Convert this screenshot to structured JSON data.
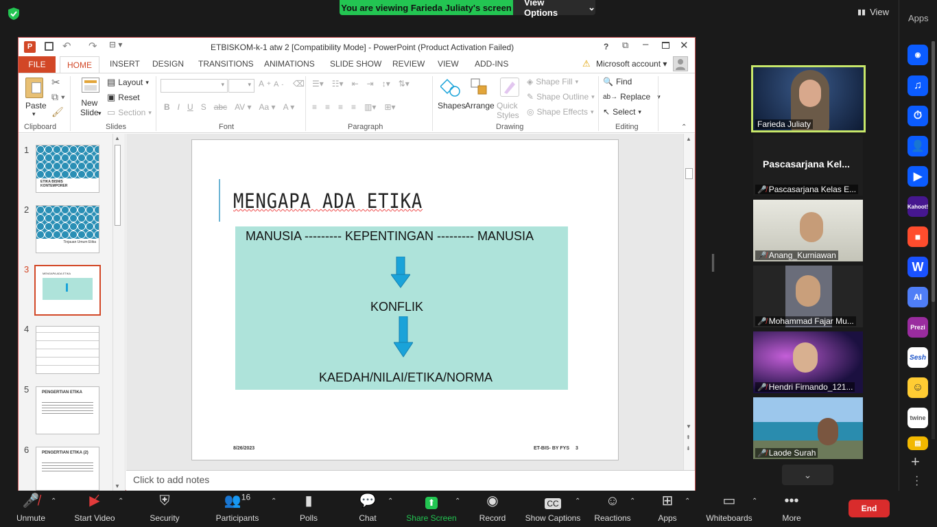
{
  "zoom": {
    "banner_text": "You are viewing Farieda Juliaty's screen",
    "view_options": "View Options",
    "view_label": "View",
    "apps_label": "Apps"
  },
  "ppt": {
    "title": "ETBISKOM-k-1 atw 2 [Compatibility Mode] - PowerPoint (Product Activation Failed)",
    "help": "?",
    "tabs": [
      "FILE",
      "HOME",
      "INSERT",
      "DESIGN",
      "TRANSITIONS",
      "ANIMATIONS",
      "SLIDE SHOW",
      "REVIEW",
      "VIEW",
      "ADD-INS"
    ],
    "account": "Microsoft account",
    "ribbon": {
      "paste": "Paste",
      "layout": "Layout",
      "reset": "Reset",
      "new_slide": "New\nSlide",
      "section": "Section",
      "shapes": "Shapes",
      "arrange": "Arrange",
      "quick_styles": "Quick Styles",
      "shape_fill": "Shape Fill",
      "shape_outline": "Shape Outline",
      "shape_effects": "Shape Effects",
      "find": "Find",
      "replace": "Replace",
      "select": "Select",
      "groups": [
        "Clipboard",
        "Slides",
        "Font",
        "Paragraph",
        "Drawing",
        "Editing"
      ]
    },
    "thumb_numbers": [
      "1",
      "2",
      "3",
      "4",
      "5",
      "6"
    ],
    "thumbs": {
      "t1": "ETIKA BISNIS KONTEMPORER",
      "t2": "Tinjauan Umum Etika",
      "t3": "MENGAPA ADA ETIKA",
      "t5": "PENGERTIAN ETIKA",
      "t6": "PENGERTIAN ETIKA (2)"
    },
    "slide": {
      "title": "MENGAPA ADA ETIKA",
      "line1": "MANUSIA --------- KEPENTINGAN --------- MANUSIA",
      "konflik": "KONFLIK",
      "bottom": "KAEDAH/NILAI/ETIKA/NORMA",
      "date": "8/26/2023",
      "footer": "ET-BIS- BY FYS",
      "page": "3"
    },
    "notes_placeholder": "Click to add notes"
  },
  "participants": [
    {
      "name": "Farieda Juliaty",
      "muted": false
    },
    {
      "name": "Pascasarjana Kelas E...",
      "big_label": "Pascasarjana  Kel...",
      "muted": true
    },
    {
      "name": "Anang_Kurniawan",
      "muted": true
    },
    {
      "name": "Mohammad Fajar Mu...",
      "muted": true
    },
    {
      "name": "Hendri Firnando_121...",
      "muted": true
    },
    {
      "name": "Laode Surah",
      "muted": true
    }
  ],
  "apps": [
    "Kahoot!",
    "Sesh",
    "twine",
    "Prezi"
  ],
  "toolbar": {
    "unmute": "Unmute",
    "start_video": "Start Video",
    "security": "Security",
    "participants": "Participants",
    "participants_count": "16",
    "polls": "Polls",
    "chat": "Chat",
    "share_screen": "Share Screen",
    "record": "Record",
    "show_captions": "Show Captions",
    "reactions": "Reactions",
    "apps": "Apps",
    "whiteboards": "Whiteboards",
    "more": "More",
    "end": "End"
  },
  "colors": {
    "accent_green": "#23c552",
    "ppt_red": "#d24726",
    "end_red": "#d92c2c",
    "slide_box": "#aee3da",
    "arrow": "#1aa3d9"
  }
}
